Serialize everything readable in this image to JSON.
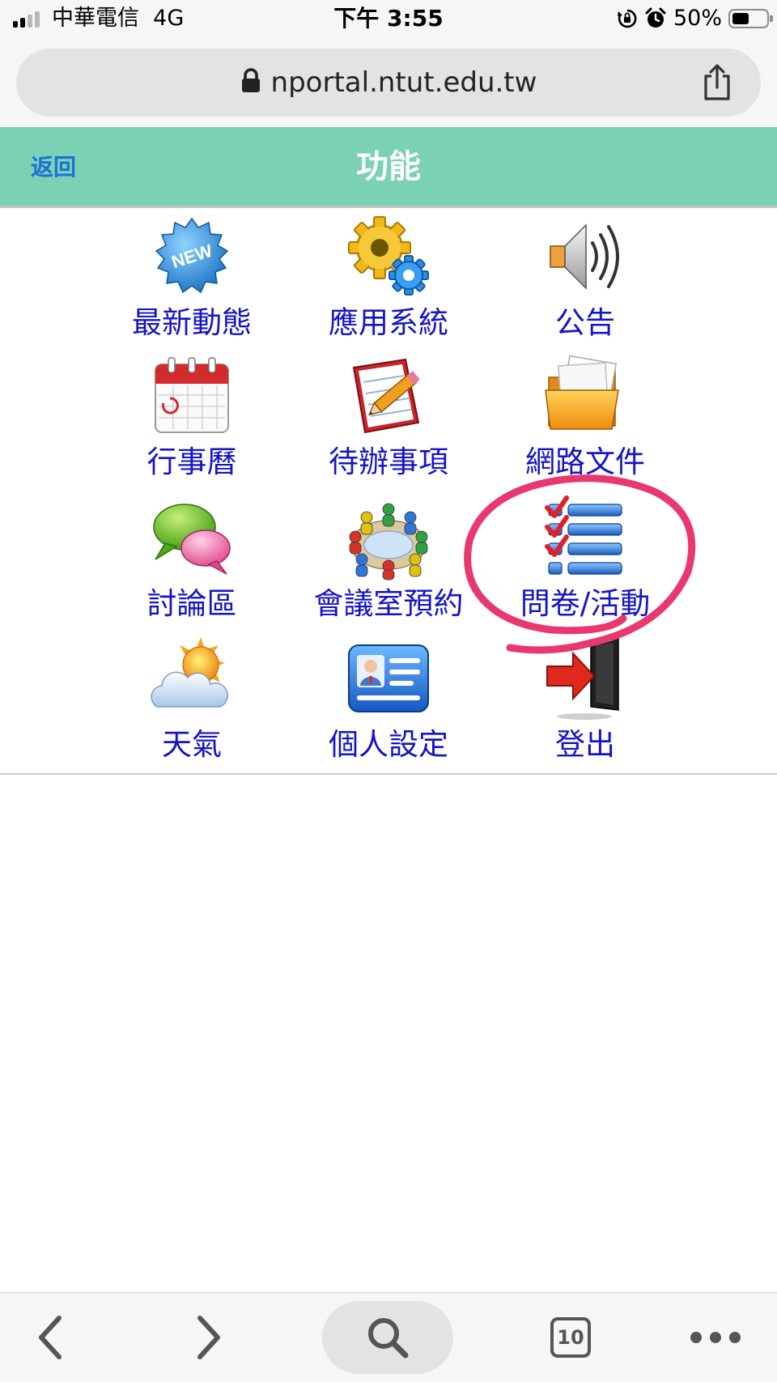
{
  "status_bar": {
    "carrier": "中華電信",
    "network": "4G",
    "time": "下午 3:55",
    "battery_percent": "50%",
    "signal_bars": 2,
    "battery_level": 0.5
  },
  "browser": {
    "url": "nportal.ntut.edu.tw",
    "lock_icon": "lock-icon",
    "share_icon": "share-icon"
  },
  "header": {
    "back_label": "返回",
    "title": "功能",
    "background_color": "#7bd1b4"
  },
  "functions": [
    {
      "label": "最新動態",
      "icon": "new-badge-icon"
    },
    {
      "label": "應用系統",
      "icon": "gears-icon"
    },
    {
      "label": "公告",
      "icon": "speaker-icon"
    },
    {
      "label": "行事曆",
      "icon": "calendar-icon"
    },
    {
      "label": "待辦事項",
      "icon": "notepad-pencil-icon"
    },
    {
      "label": "網路文件",
      "icon": "folder-icon"
    },
    {
      "label": "討論區",
      "icon": "chat-bubbles-icon"
    },
    {
      "label": "會議室預約",
      "icon": "meeting-people-icon"
    },
    {
      "label": "問卷/活動",
      "icon": "checklist-icon"
    },
    {
      "label": "天氣",
      "icon": "weather-sun-cloud-icon"
    },
    {
      "label": "個人設定",
      "icon": "profile-card-icon"
    },
    {
      "label": "登出",
      "icon": "logout-door-icon"
    }
  ],
  "annotation": {
    "target": "問卷/活動",
    "color": "#e8386e"
  },
  "toolbar": {
    "back_icon": "chevron-left-icon",
    "forward_icon": "chevron-right-icon",
    "search_icon": "search-icon",
    "tab_count": "10",
    "more_icon": "more-dots-icon"
  }
}
